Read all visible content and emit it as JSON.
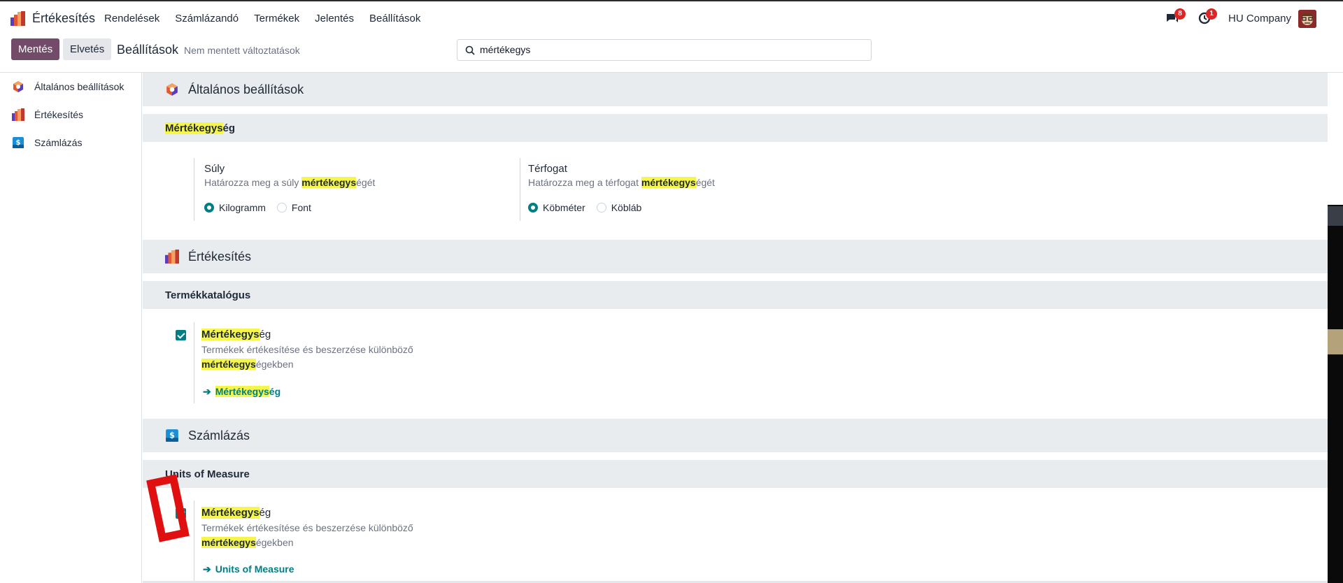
{
  "navbar": {
    "app_name": "Értékesítés",
    "menu": [
      "Rendelések",
      "Számlázandó",
      "Termékek",
      "Jelentés",
      "Beállítások"
    ],
    "messages_badge": "8",
    "activities_badge": "1",
    "company": "HU Company",
    "icons": {
      "app": "sales-app-icon",
      "messages": "chat-icon",
      "activities": "clock-icon",
      "user": "avatar"
    }
  },
  "control_panel": {
    "save_label": "Mentés",
    "discard_label": "Elvetés",
    "title": "Beállítások",
    "unsaved_note": "Nem mentett változtatások",
    "search_value": "mértékegys"
  },
  "sidebar": {
    "items": [
      {
        "label": "Általános beállítások",
        "icon": "settings-app-icon"
      },
      {
        "label": "Értékesítés",
        "icon": "sales-app-icon"
      },
      {
        "label": "Számlázás",
        "icon": "invoicing-app-icon"
      }
    ]
  },
  "general": {
    "title": "Általános beállítások",
    "section": {
      "highlight": "Mértékegys",
      "rest": "ég"
    },
    "weight": {
      "name": "Súly",
      "desc_before": "Határozza meg a súly ",
      "desc_highlight": "mértékegys",
      "desc_after": "égét",
      "options": [
        "Kilogramm",
        "Font"
      ],
      "selected": "Kilogramm"
    },
    "volume": {
      "name": "Térfogat",
      "desc_before": "Határozza meg a térfogat ",
      "desc_highlight": "mértékegys",
      "desc_after": "égét",
      "options": [
        "Köbméter",
        "Köbláb"
      ],
      "selected": "Köbméter"
    }
  },
  "sales": {
    "title": "Értékesítés",
    "section": "Termékkatalógus",
    "setting": {
      "name_highlight": "Mértékegys",
      "name_rest": "ég",
      "desc_line1": "Termékek értékesítése és beszerzése különböző",
      "desc_highlight": "mértékegys",
      "desc_after": "égekben",
      "checked": true,
      "link_highlight": "Mértékegys",
      "link_rest": "ég"
    }
  },
  "invoicing": {
    "title": "Számlázás",
    "section": "Units of Measure",
    "setting": {
      "name_highlight": "Mértékegys",
      "name_rest": "ég",
      "desc_line1": "Termékek értékesítése és beszerzése különböző",
      "desc_highlight": "mértékegys",
      "desc_after": "égekben",
      "checked": true,
      "link_label": "Units of Measure"
    }
  },
  "colors": {
    "primary": "#714b67",
    "teal": "#017e84",
    "highlight": "#f5f54a",
    "badge": "#dc2626",
    "annotation": "#e01010"
  }
}
